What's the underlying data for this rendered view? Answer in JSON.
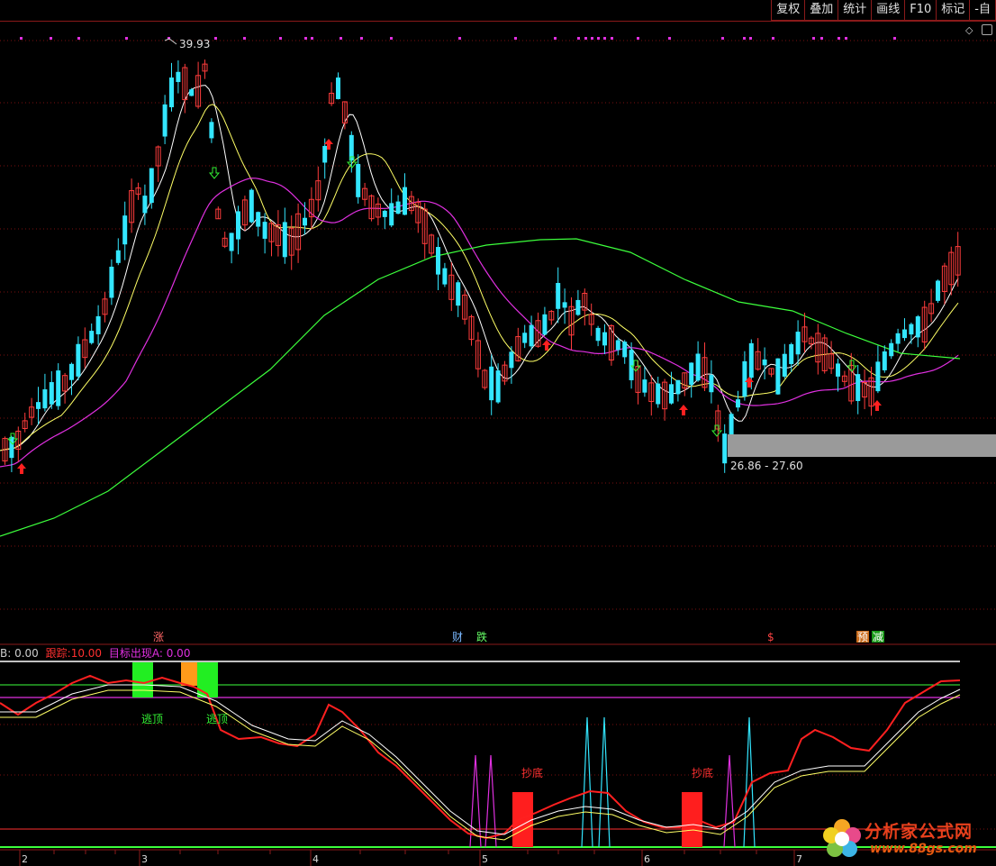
{
  "toolbar": {
    "buttons": [
      "复权",
      "叠加",
      "统计",
      "画线",
      "F10",
      "标记",
      "-自"
    ]
  },
  "main_chart": {
    "high_label": "39.93",
    "range_label": "26.86 - 27.60",
    "colors": {
      "up": "#ff3c3c",
      "down": "#33e6ff",
      "ma5": "#ffffff",
      "ma10": "#ffff66",
      "ma20": "#e030e0",
      "ma60": "#3cff3c"
    }
  },
  "event_markers": {
    "zhang": "涨",
    "cai": "财",
    "die": "跌",
    "dollar": "$",
    "yu": "预",
    "jian": "减"
  },
  "indicator": {
    "legend_b": "B: 0.00",
    "legend_track_label": "跟踪:",
    "legend_track_value": "10.00",
    "legend_target": "目标出现A: 0.00",
    "escape_label_1": "逃顶",
    "escape_label_2": "逃顶",
    "bottom_label_1": "抄底",
    "bottom_label_2": "抄底"
  },
  "x_axis": {
    "months": [
      "2",
      "3",
      "4",
      "5",
      "6",
      "7"
    ]
  },
  "logo": {
    "title": "分析家公式网",
    "url": "www.88gs.com"
  }
}
